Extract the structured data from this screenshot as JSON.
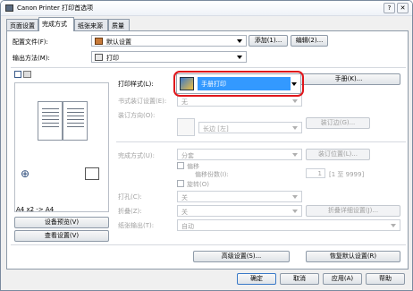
{
  "window": {
    "title": "Canon Printer 打印首选项"
  },
  "tabs": [
    {
      "label": "页面设置"
    },
    {
      "label": "完成方式"
    },
    {
      "label": "纸张来源"
    },
    {
      "label": "质量"
    }
  ],
  "profile": {
    "label": "配置文件(F):",
    "value": "默认设置",
    "add_button": "添加(1)...",
    "edit_button": "编辑(2)..."
  },
  "output": {
    "label": "输出方法(M):",
    "value": "打印"
  },
  "print_style": {
    "label": "打印样式(L):",
    "value": "手册打印",
    "manual_button": "手册(K)..."
  },
  "booklet_settings": {
    "label": "书式装订设置(E):",
    "value": "无"
  },
  "binding_direction": {
    "label": "装订方向(O):",
    "value": "长边 [左]",
    "position_button": "装订边(G)..."
  },
  "finishing": {
    "label": "完成方式(U):",
    "value": "分套",
    "position_button": "装订位置(L)..."
  },
  "offset": {
    "label": "偏移",
    "count_label": "偏移份数(I):",
    "count_value": "1",
    "range": "[1 至 9999]"
  },
  "rotate": {
    "label": "旋转(O)"
  },
  "punch": {
    "label": "打孔(C):",
    "value": "关"
  },
  "fold": {
    "label": "折叠(Z):",
    "value": "关",
    "detail_button": "折叠详细设置(J)..."
  },
  "output_tray": {
    "label": "纸张输出(T):",
    "value": "自动"
  },
  "preview": {
    "paper_text": "A4 x2 -> A4",
    "settings_button": "设备预览(V)",
    "view_button": "查看设置(V)"
  },
  "bottom": {
    "advanced_button": "高级设置(S)...",
    "restore_button": "恢复默认设置(R)"
  },
  "dialog": {
    "ok": "确定",
    "cancel": "取消",
    "apply": "应用(A)",
    "help": "帮助"
  }
}
